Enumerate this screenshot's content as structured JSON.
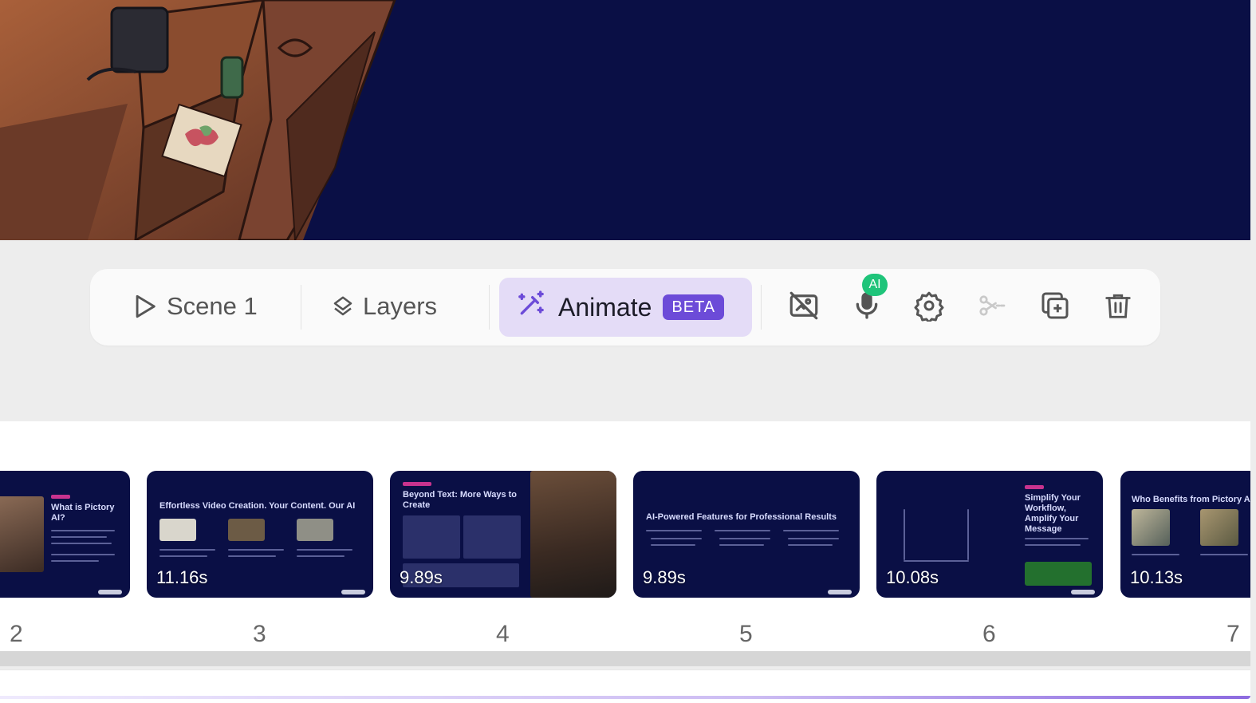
{
  "toolbar": {
    "scene_label": "Scene 1",
    "layers_label": "Layers",
    "animate_label": "Animate",
    "beta_label": "BETA",
    "ai_badge": "AI",
    "icons": [
      "play-icon",
      "layers-icon",
      "magic-wand-icon",
      "hide-visual-icon",
      "microphone-icon",
      "gear-icon",
      "scissors-icon",
      "duplicate-icon",
      "trash-icon"
    ]
  },
  "timeline": {
    "scenes": [
      {
        "number": "2",
        "title": "What is Pictory AI?",
        "duration": ""
      },
      {
        "number": "3",
        "title": "Effortless Video Creation. Your Content. Our AI",
        "duration": "11.16s"
      },
      {
        "number": "4",
        "title": "Beyond Text: More Ways to Create",
        "duration": "9.89s"
      },
      {
        "number": "5",
        "title": "AI-Powered Features for Professional Results",
        "duration": "9.89s"
      },
      {
        "number": "6",
        "title": "Simplify Your Workflow, Amplify Your Message",
        "duration": "10.08s"
      },
      {
        "number": "7",
        "title": "Who Benefits from Pictory A",
        "duration": "10.13s"
      }
    ]
  },
  "colors": {
    "accent": "#6c4bd8",
    "animate_bg": "#e4dcf7",
    "ai_badge": "#1fc47a",
    "slide_bg": "#0a0f45"
  }
}
